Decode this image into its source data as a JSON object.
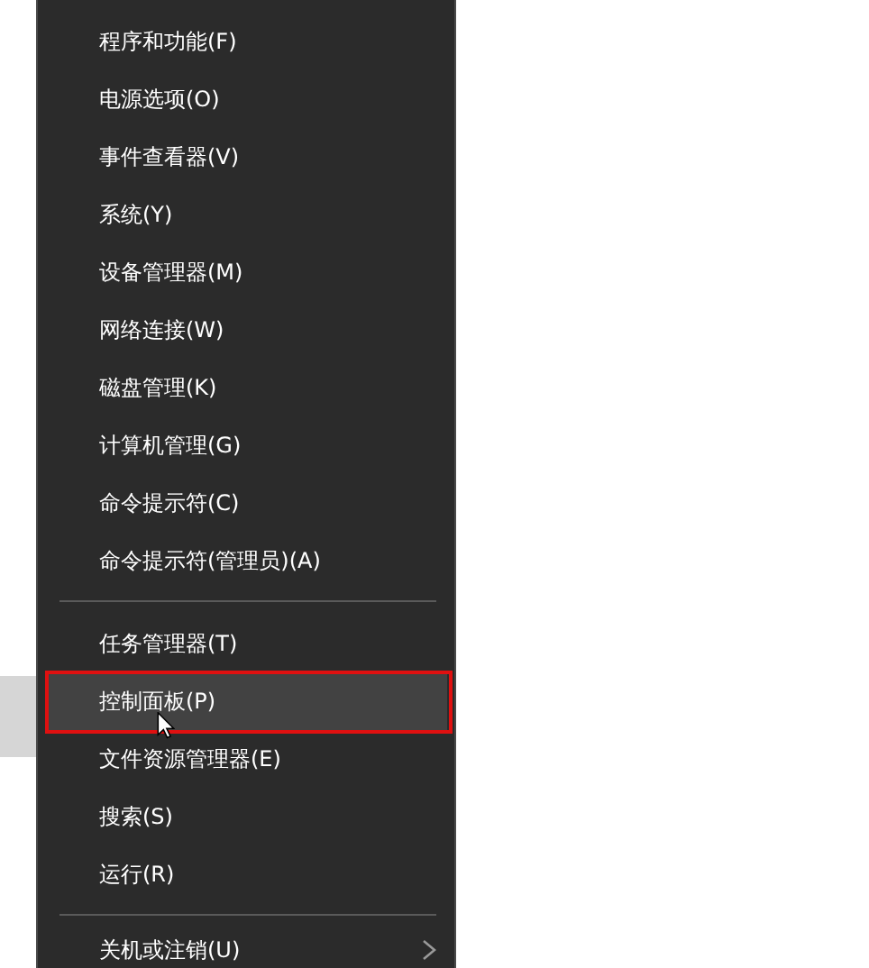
{
  "menu": {
    "groups": [
      {
        "items": [
          {
            "label": "程序和功能(F)",
            "selected": false,
            "annotated": false,
            "submenu": false
          },
          {
            "label": "电源选项(O)",
            "selected": false,
            "annotated": false,
            "submenu": false
          },
          {
            "label": "事件查看器(V)",
            "selected": false,
            "annotated": false,
            "submenu": false
          },
          {
            "label": "系统(Y)",
            "selected": false,
            "annotated": false,
            "submenu": false
          },
          {
            "label": "设备管理器(M)",
            "selected": false,
            "annotated": false,
            "submenu": false
          },
          {
            "label": "网络连接(W)",
            "selected": false,
            "annotated": false,
            "submenu": false
          },
          {
            "label": "磁盘管理(K)",
            "selected": false,
            "annotated": false,
            "submenu": false
          },
          {
            "label": "计算机管理(G)",
            "selected": false,
            "annotated": false,
            "submenu": false
          },
          {
            "label": "命令提示符(C)",
            "selected": false,
            "annotated": false,
            "submenu": false
          },
          {
            "label": "命令提示符(管理员)(A)",
            "selected": false,
            "annotated": false,
            "submenu": false
          }
        ]
      },
      {
        "items": [
          {
            "label": "任务管理器(T)",
            "selected": false,
            "annotated": false,
            "submenu": false
          },
          {
            "label": "控制面板(P)",
            "selected": true,
            "annotated": true,
            "submenu": false
          },
          {
            "label": "文件资源管理器(E)",
            "selected": false,
            "annotated": false,
            "submenu": false
          },
          {
            "label": "搜索(S)",
            "selected": false,
            "annotated": false,
            "submenu": false
          },
          {
            "label": "运行(R)",
            "selected": false,
            "annotated": false,
            "submenu": false
          }
        ]
      },
      {
        "items": [
          {
            "label": "关机或注销(U)",
            "selected": false,
            "annotated": false,
            "submenu": true
          }
        ]
      }
    ]
  }
}
